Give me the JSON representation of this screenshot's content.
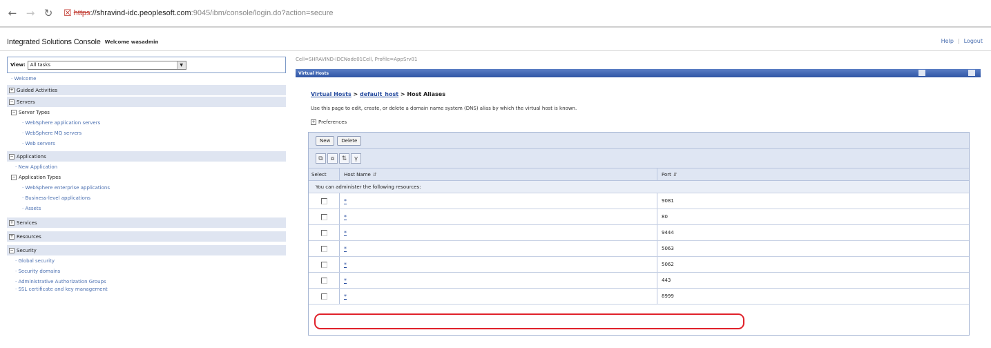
{
  "browser": {
    "scheme": "https",
    "host": "://shravind-idc.peoplesoft.com",
    "path": ":9045/ibm/console/login.do?action=secure"
  },
  "console": {
    "title": "Integrated Solutions Console",
    "welcome": "Welcome wasadmin",
    "help": "Help",
    "logout": "Logout"
  },
  "nav": {
    "view_label": "View:",
    "view_value": "All tasks",
    "welcome": "Welcome",
    "guided": "Guided Activities",
    "servers": "Servers",
    "server_types": "Server Types",
    "server_links": [
      "WebSphere application servers",
      "WebSphere MQ servers",
      "Web servers"
    ],
    "applications": "Applications",
    "new_application": "New Application",
    "application_types": "Application Types",
    "app_links": [
      "WebSphere enterprise applications",
      "Business-level applications",
      "Assets"
    ],
    "services": "Services",
    "resources": "Resources",
    "security": "Security",
    "security_links": [
      "Global security",
      "Security domains",
      "Administrative Authorization Groups",
      "SSL certificate and key management"
    ]
  },
  "main": {
    "cell_info": "Cell=SHRAVIND-IDCNode01Cell, Profile=AppSrv01",
    "portlet_title": "Virtual Hosts",
    "breadcrumb": {
      "virtual_hosts": "Virtual Hosts",
      "sep": " > ",
      "default_host": "default_host",
      "current": "Host Aliases"
    },
    "description": "Use this page to edit, create, or delete a domain name system (DNS) alias by which the virtual host is known.",
    "preferences": "Preferences",
    "new_button": "New",
    "delete_button": "Delete",
    "columns": {
      "select": "Select",
      "host": "Host Name",
      "port": "Port"
    },
    "info_text": "You can administer the following resources:",
    "rows": [
      {
        "host": "*",
        "port": "9081"
      },
      {
        "host": "*",
        "port": "80"
      },
      {
        "host": "*",
        "port": "9444"
      },
      {
        "host": "*",
        "port": "5063"
      },
      {
        "host": "*",
        "port": "5062"
      },
      {
        "host": "*",
        "port": "443"
      },
      {
        "host": "*",
        "port": "8999"
      }
    ]
  },
  "colors": {
    "highlight": "#e0212a",
    "link": "#4a6fb0",
    "portlet": "#2f55a5"
  }
}
